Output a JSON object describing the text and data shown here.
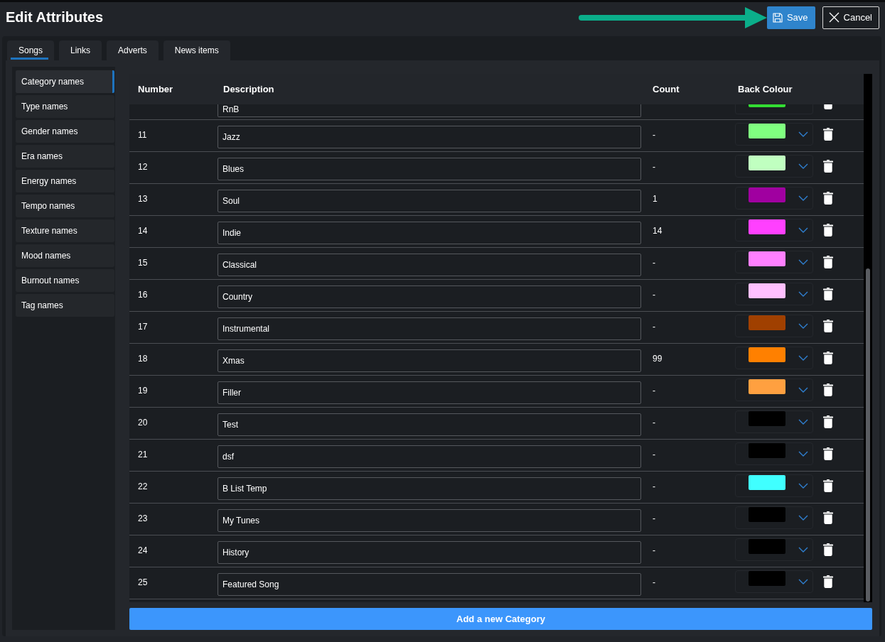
{
  "window": {
    "title": "Edit Attributes"
  },
  "toolbar": {
    "buttons": [
      {
        "kind": "save",
        "label": "Save"
      },
      {
        "kind": "cancel",
        "label": "Cancel"
      }
    ]
  },
  "tabs": [
    {
      "label": "Songs",
      "selected": true
    },
    {
      "label": "Links",
      "selected": false
    },
    {
      "label": "Adverts",
      "selected": false
    },
    {
      "label": "News items",
      "selected": false
    }
  ],
  "sidebar": {
    "items": [
      {
        "label": "Category names",
        "selected": true
      },
      {
        "label": "Type names",
        "selected": false
      },
      {
        "label": "Gender names",
        "selected": false
      },
      {
        "label": "Era names",
        "selected": false
      },
      {
        "label": "Energy names",
        "selected": false
      },
      {
        "label": "Tempo names",
        "selected": false
      },
      {
        "label": "Texture names",
        "selected": false
      },
      {
        "label": "Mood names",
        "selected": false
      },
      {
        "label": "Burnout names",
        "selected": false
      },
      {
        "label": "Tag names",
        "selected": false
      }
    ]
  },
  "table": {
    "columns": [
      "Number",
      "Description",
      "Count",
      "Back Colour"
    ],
    "rows": [
      {
        "kind": "partial",
        "description": "RnB",
        "color": "#33dd33"
      },
      {
        "kind": "full",
        "number": "11",
        "description": "Jazz",
        "count": "-",
        "color": "#80ff80"
      },
      {
        "kind": "full",
        "number": "12",
        "description": "Blues",
        "count": "-",
        "color": "#c0ffc0"
      },
      {
        "kind": "full",
        "number": "13",
        "description": "Soul",
        "count": "1",
        "color": "#a000a0"
      },
      {
        "kind": "full",
        "number": "14",
        "description": "Indie",
        "count": "14",
        "color": "#ff40ff"
      },
      {
        "kind": "full",
        "number": "15",
        "description": "Classical",
        "count": "-",
        "color": "#ff80ff"
      },
      {
        "kind": "full",
        "number": "16",
        "description": "Country",
        "count": "-",
        "color": "#ffc0ff"
      },
      {
        "kind": "full",
        "number": "17",
        "description": "Instrumental",
        "count": "-",
        "color": "#a04000"
      },
      {
        "kind": "full",
        "number": "18",
        "description": "Xmas",
        "count": "99",
        "color": "#ff8000"
      },
      {
        "kind": "full",
        "number": "19",
        "description": "Filler",
        "count": "-",
        "color": "#ffa040"
      },
      {
        "kind": "full",
        "number": "20",
        "description": "Test",
        "count": "-",
        "color": "#000000"
      },
      {
        "kind": "full",
        "number": "21",
        "description": "dsf",
        "count": "-",
        "color": "#000000"
      },
      {
        "kind": "full",
        "number": "22",
        "description": "B List Temp",
        "count": "-",
        "color": "#40ffff"
      },
      {
        "kind": "full",
        "number": "23",
        "description": "My Tunes",
        "count": "-",
        "color": "#000000"
      },
      {
        "kind": "full",
        "number": "24",
        "description": "History",
        "count": "-",
        "color": "#000000"
      },
      {
        "kind": "full",
        "number": "25",
        "description": "Featured Song",
        "count": "-",
        "color": "#000000"
      }
    ]
  },
  "add_button": {
    "label": "Add a new Category"
  }
}
